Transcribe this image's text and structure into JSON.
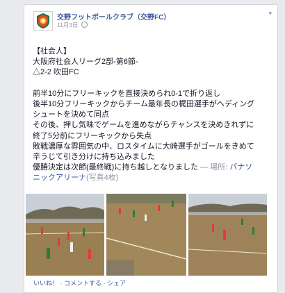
{
  "post": {
    "page_name": "交野フットボールクラブ（交野FC）",
    "date": "11月3日",
    "lines": [
      "【社会人】",
      "大阪府社会人リーグ2部-第6節-",
      "△2-2 吹田FC",
      "",
      "前半10分にフリーキックを直接決められ0-1で折り返し",
      "後半10分フリーキックからチーム最年長の梶田選手がヘディング",
      "シュートを決めて同点",
      "その後、押し気味でゲームを進めながらチャンスを決めきれずに",
      "終了5分前にフリーキックから失点",
      "敗戦濃厚な雰囲気の中、ロスタイムに大崎選手がゴールをきめて",
      "辛うじて引き分けに持ち込みました"
    ],
    "last_line": "優勝決定は次節(最終戦)に持ち越しとなりました",
    "place_prefix": "— 場所:",
    "place_name_1": "パナソ",
    "place_name_2": "ニックアリーナ",
    "photo_count": "(写真4枚)"
  },
  "actions": {
    "like": "いいね！",
    "comment": "コメントする",
    "share": "シェア",
    "separator": "·"
  },
  "colors": {
    "link": "#3b5998",
    "text": "#141823",
    "muted": "#9197a3",
    "background": "#e9eaed"
  }
}
